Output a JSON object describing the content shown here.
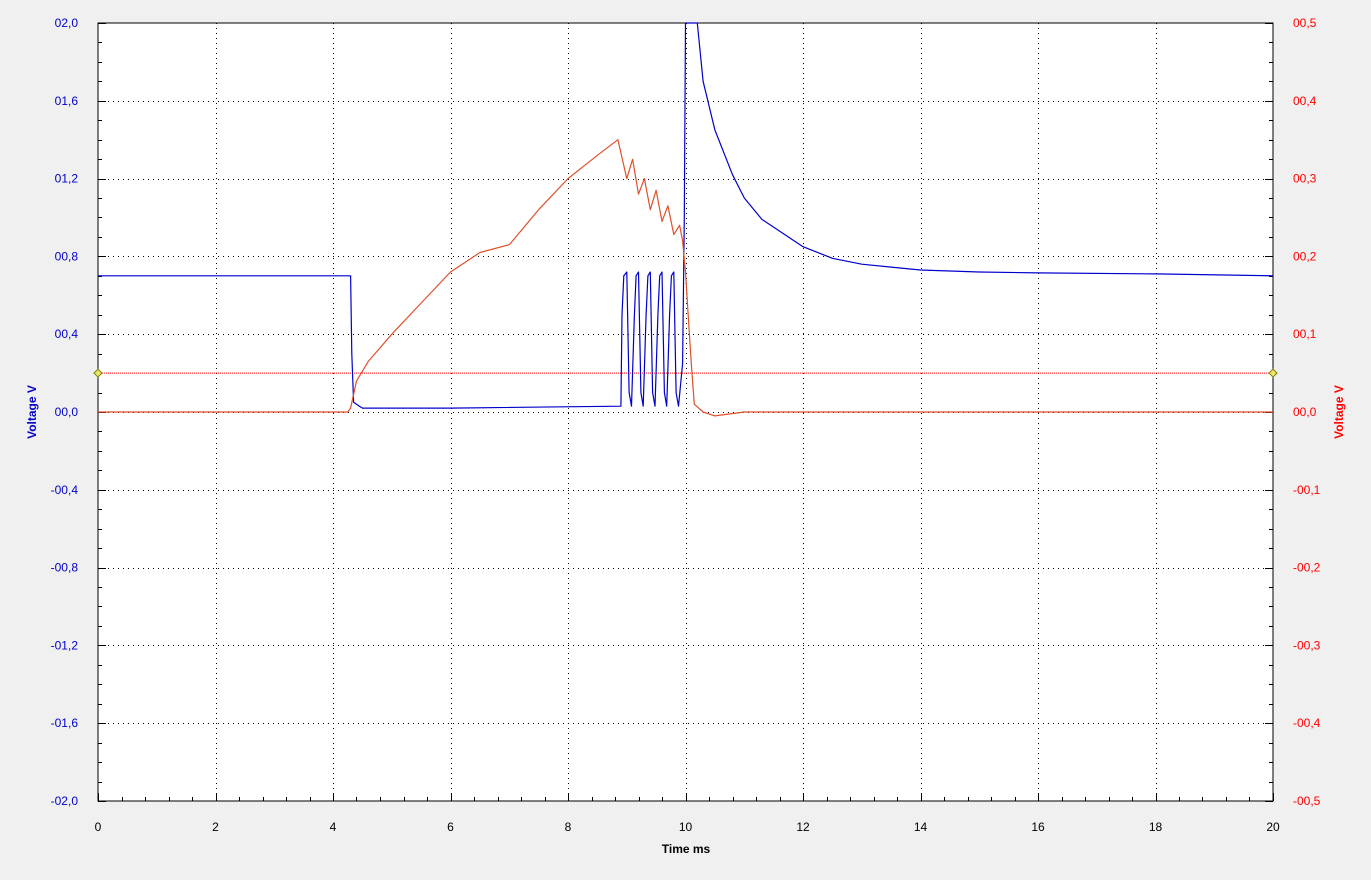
{
  "chart_data": {
    "type": "line",
    "xlabel": "Time ms",
    "xlim": [
      0,
      20
    ],
    "x_ticks": [
      0,
      2,
      4,
      6,
      8,
      10,
      12,
      14,
      16,
      18,
      20
    ],
    "x_tick_labels": [
      "0",
      "2",
      "4",
      "6",
      "8",
      "10",
      "12",
      "14",
      "16",
      "18",
      "20"
    ],
    "grid": true,
    "left_axis": {
      "label": "Voltage V",
      "color": "#0000cc",
      "ylim": [
        -2.0,
        2.0
      ],
      "ticks": [
        2.0,
        1.6,
        1.2,
        0.8,
        0.4,
        0.0,
        -0.4,
        -0.8,
        -1.2,
        -1.6,
        -2.0
      ],
      "tick_labels": [
        "02,0",
        "01,6",
        "01,2",
        "00,8",
        "00,4",
        "00,0",
        "-00,4",
        "-00,8",
        "-01,2",
        "-01,6",
        "-02,0"
      ]
    },
    "right_axis": {
      "label": "Voltage V",
      "color": "#ff0000",
      "ylim": [
        -0.5,
        0.5
      ],
      "ticks": [
        0.5,
        0.4,
        0.3,
        0.2,
        0.1,
        0.0,
        -0.1,
        -0.2,
        -0.3,
        -0.4,
        -0.5
      ],
      "tick_labels": [
        "00,5",
        "00,4",
        "00,3",
        "00,2",
        "00,1",
        "00,0",
        "-00,1",
        "-00,2",
        "-00,3",
        "-00,4",
        "-00,5"
      ]
    },
    "trigger_level": {
      "axis": "right",
      "value": 0.05,
      "color": "#ff0000"
    },
    "series": [
      {
        "axis": "left",
        "color": "#0000cc",
        "points": [
          [
            0,
            0.7
          ],
          [
            4.3,
            0.7
          ],
          [
            4.32,
            0.3
          ],
          [
            4.35,
            0.05
          ],
          [
            4.45,
            0.03
          ],
          [
            4.5,
            0.02
          ],
          [
            6.0,
            0.02
          ],
          [
            8.9,
            0.03
          ],
          [
            8.92,
            0.5
          ],
          [
            8.95,
            0.7
          ],
          [
            9.0,
            0.72
          ],
          [
            9.04,
            0.1
          ],
          [
            9.08,
            0.03
          ],
          [
            9.13,
            0.5
          ],
          [
            9.16,
            0.7
          ],
          [
            9.2,
            0.72
          ],
          [
            9.24,
            0.1
          ],
          [
            9.28,
            0.03
          ],
          [
            9.33,
            0.5
          ],
          [
            9.36,
            0.7
          ],
          [
            9.4,
            0.72
          ],
          [
            9.44,
            0.1
          ],
          [
            9.48,
            0.03
          ],
          [
            9.53,
            0.5
          ],
          [
            9.56,
            0.7
          ],
          [
            9.6,
            0.72
          ],
          [
            9.64,
            0.1
          ],
          [
            9.68,
            0.03
          ],
          [
            9.73,
            0.5
          ],
          [
            9.76,
            0.7
          ],
          [
            9.8,
            0.72
          ],
          [
            9.84,
            0.1
          ],
          [
            9.88,
            0.03
          ],
          [
            9.95,
            0.25
          ],
          [
            9.98,
            1.0
          ],
          [
            10.0,
            2.0
          ],
          [
            10.2,
            2.0
          ],
          [
            10.3,
            1.7
          ],
          [
            10.5,
            1.45
          ],
          [
            10.8,
            1.22
          ],
          [
            11.0,
            1.1
          ],
          [
            11.3,
            0.99
          ],
          [
            11.7,
            0.91
          ],
          [
            12.0,
            0.85
          ],
          [
            12.5,
            0.79
          ],
          [
            13.0,
            0.76
          ],
          [
            13.5,
            0.745
          ],
          [
            14.0,
            0.73
          ],
          [
            15.0,
            0.72
          ],
          [
            16.0,
            0.715
          ],
          [
            18.0,
            0.71
          ],
          [
            20.0,
            0.7
          ]
        ]
      },
      {
        "axis": "right",
        "color": "#e0502a",
        "points": [
          [
            0,
            0.0
          ],
          [
            4.25,
            0.0
          ],
          [
            4.3,
            0.005
          ],
          [
            4.4,
            0.04
          ],
          [
            4.6,
            0.065
          ],
          [
            5.0,
            0.1
          ],
          [
            5.5,
            0.14
          ],
          [
            6.0,
            0.18
          ],
          [
            6.5,
            0.205
          ],
          [
            7.0,
            0.215
          ],
          [
            7.5,
            0.26
          ],
          [
            8.0,
            0.3
          ],
          [
            8.5,
            0.33
          ],
          [
            8.85,
            0.35
          ],
          [
            9.0,
            0.3
          ],
          [
            9.1,
            0.325
          ],
          [
            9.2,
            0.28
          ],
          [
            9.3,
            0.3
          ],
          [
            9.4,
            0.26
          ],
          [
            9.5,
            0.285
          ],
          [
            9.6,
            0.245
          ],
          [
            9.7,
            0.265
          ],
          [
            9.8,
            0.228
          ],
          [
            9.9,
            0.24
          ],
          [
            9.95,
            0.22
          ],
          [
            10.0,
            0.18
          ],
          [
            10.05,
            0.12
          ],
          [
            10.1,
            0.06
          ],
          [
            10.15,
            0.01
          ],
          [
            10.3,
            0.0
          ],
          [
            10.5,
            -0.005
          ],
          [
            11.0,
            0.0
          ],
          [
            20.0,
            0.0
          ]
        ]
      }
    ]
  }
}
